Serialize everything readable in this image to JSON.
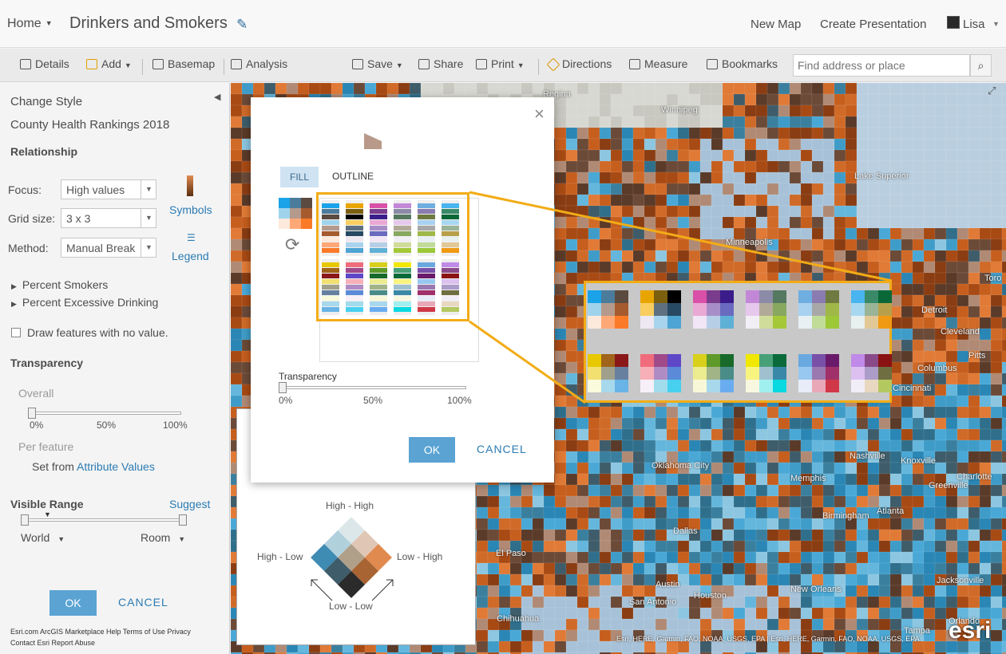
{
  "header": {
    "home_label": "Home",
    "map_title": "Drinkers and Smokers",
    "new_map": "New Map",
    "create_presentation": "Create Presentation",
    "user": "Lisa"
  },
  "toolbar": {
    "details": "Details",
    "add": "Add",
    "basemap": "Basemap",
    "analysis": "Analysis",
    "save": "Save",
    "share": "Share",
    "print": "Print",
    "directions": "Directions",
    "measure": "Measure",
    "bookmarks": "Bookmarks",
    "search_placeholder": "Find address or place"
  },
  "panel": {
    "title": "Change Style",
    "layer": "County Health Rankings 2018",
    "relationship": "Relationship",
    "focus_label": "Focus:",
    "focus_value": "High values",
    "grid_label": "Grid size:",
    "grid_value": "3 x 3",
    "method_label": "Method:",
    "method_value": "Manual Break",
    "symbols": "Symbols",
    "legend": "Legend",
    "field1": "Percent Smokers",
    "field2": "Percent Excessive Drinking",
    "no_value": "Draw features with no value.",
    "transparency": "Transparency",
    "overall": "Overall",
    "t0": "0%",
    "t50": "50%",
    "t100": "100%",
    "overall_value": 0,
    "per_feature": "Per feature",
    "set_from": "Set from",
    "attr_values": "Attribute Values",
    "visible_range": "Visible Range",
    "suggest": "Suggest",
    "world": "World",
    "room": "Room",
    "ok": "OK",
    "cancel": "CANCEL",
    "footer_line1": "Esri.com  ArcGIS Marketplace  Help  Terms of Use  Privacy",
    "footer_line2": "Contact Esri  Report Abuse"
  },
  "legend_box": {
    "high_high": "High - High",
    "high_low": "High - Low",
    "low_high": "Low - High",
    "low_low": "Low - Low"
  },
  "dialog": {
    "tab_fill": "FILL",
    "tab_outline": "OUTLINE",
    "transparency": "Transparency",
    "t0": "0%",
    "t50": "50%",
    "t100": "100%",
    "transparency_value": 0,
    "ok": "OK",
    "cancel": "CANCEL"
  },
  "map_labels": [
    {
      "key": "regina",
      "text": "Regina"
    },
    {
      "key": "winnipeg",
      "text": "Winnipeg"
    },
    {
      "key": "minneapolis",
      "text": "Minneapolis"
    },
    {
      "key": "detroit",
      "text": "Detroit"
    },
    {
      "key": "cleveland",
      "text": "Cleveland"
    },
    {
      "key": "columbus",
      "text": "Columbus"
    },
    {
      "key": "cincinnati",
      "text": "Cincinnati"
    },
    {
      "key": "oklahoma",
      "text": "Oklahoma City"
    },
    {
      "key": "nashville",
      "text": "Nashville"
    },
    {
      "key": "memphis",
      "text": "Memphis"
    },
    {
      "key": "knoxville",
      "text": "Knoxville"
    },
    {
      "key": "charlotte",
      "text": "Charlotte"
    },
    {
      "key": "greenville",
      "text": "Greenville"
    },
    {
      "key": "atlanta",
      "text": "Atlanta"
    },
    {
      "key": "birmingham",
      "text": "Birmingham"
    },
    {
      "key": "dallas",
      "text": "Dallas"
    },
    {
      "key": "elpaso",
      "text": "El Paso"
    },
    {
      "key": "austin",
      "text": "Austin"
    },
    {
      "key": "sanantonio",
      "text": "San Antonio"
    },
    {
      "key": "houston",
      "text": "Houston"
    },
    {
      "key": "chihuahua",
      "text": "Chihuahua"
    },
    {
      "key": "neworleans",
      "text": "New Orleans"
    },
    {
      "key": "jacksonville",
      "text": "Jacksonville"
    },
    {
      "key": "tampa",
      "text": "Tampa"
    },
    {
      "key": "orlando",
      "text": "Orlando"
    },
    {
      "key": "lakesuperior",
      "text": "Lake Superior"
    },
    {
      "key": "toronto",
      "text": "Toro"
    },
    {
      "key": "pittsburgh",
      "text": "Pitts"
    }
  ],
  "attribution": "Esri, HERE, Garmin, FAO, NOAA, USGS, EPA | Esri, HERE, Garmin, FAO, NOAA, USGS, EPA",
  "logo": "esri",
  "palettes": [
    [
      "#1aa3e8",
      "#4c7c9c",
      "#5b4a3f",
      "#9fd3ec",
      "#b49a8c",
      "#a65b2e",
      "#fde9dc",
      "#ffa877",
      "#fb7a27"
    ],
    [
      "#e8a500",
      "#7b5f0e",
      "#000000",
      "#f9ce5f",
      "#5f7080",
      "#274963",
      "#ede8f2",
      "#a9d3ec",
      "#4ea4d3"
    ],
    [
      "#d850a8",
      "#7a3c8c",
      "#3a1d8a",
      "#eaa8d4",
      "#a88ec8",
      "#6a6ac0",
      "#f0e6f6",
      "#b7cfe6",
      "#5fb0d6"
    ],
    [
      "#c387d8",
      "#8b8ba8",
      "#547960",
      "#e5c8ec",
      "#b2aa98",
      "#88a860",
      "#f2eef6",
      "#d0dc9a",
      "#a4c838"
    ],
    [
      "#6faee0",
      "#8a7cb0",
      "#6e7a40",
      "#a8d2f0",
      "#a9a8a8",
      "#9fb848",
      "#e8f0f4",
      "#c0dc98",
      "#9cc838"
    ],
    [
      "#48b4f0",
      "#3a8a6a",
      "#0a6838",
      "#a8d8f0",
      "#9ab498",
      "#b8a04a",
      "#e8f0f0",
      "#e2c896",
      "#f09a14"
    ],
    [
      "#e8c800",
      "#a0641a",
      "#8a1818",
      "#f2e070",
      "#a0a08c",
      "#6880a0",
      "#fafadc",
      "#a8d8ec",
      "#68b4e6"
    ],
    [
      "#f06c7c",
      "#a04a8a",
      "#5f48c8",
      "#f8b0b8",
      "#b08cc4",
      "#5a8ad8",
      "#f8f0f8",
      "#a0dcec",
      "#48d0f0"
    ],
    [
      "#d8d01a",
      "#5e9a2a",
      "#186a2a",
      "#ecec90",
      "#a0b488",
      "#4a8c88",
      "#f8f8d8",
      "#a8d8ec",
      "#6aacf0"
    ],
    [
      "#f0e800",
      "#48a078",
      "#0a6a3a",
      "#f8f480",
      "#a0c0d0",
      "#3a88a8",
      "#f8f8e0",
      "#a0f0f0",
      "#08d8e0"
    ],
    [
      "#6aa8e0",
      "#7850a8",
      "#6a1a6a",
      "#98c8f0",
      "#9a78b0",
      "#a0306a",
      "#e8ecf8",
      "#e8a8b8",
      "#d03848"
    ],
    [
      "#c08ae8",
      "#8a4a8a",
      "#8a1212",
      "#dcc0f0",
      "#ac9cc8",
      "#6e6e40",
      "#f2eef8",
      "#e8d8c0",
      "#b4c860"
    ]
  ],
  "bivariate": [
    "#dce7ea",
    "#e0c6b4",
    "#e08a4f",
    "#b0d0dc",
    "#b0a08a",
    "#a86432",
    "#3e8bb4",
    "#3e5c6a",
    "#2b2b2b"
  ]
}
